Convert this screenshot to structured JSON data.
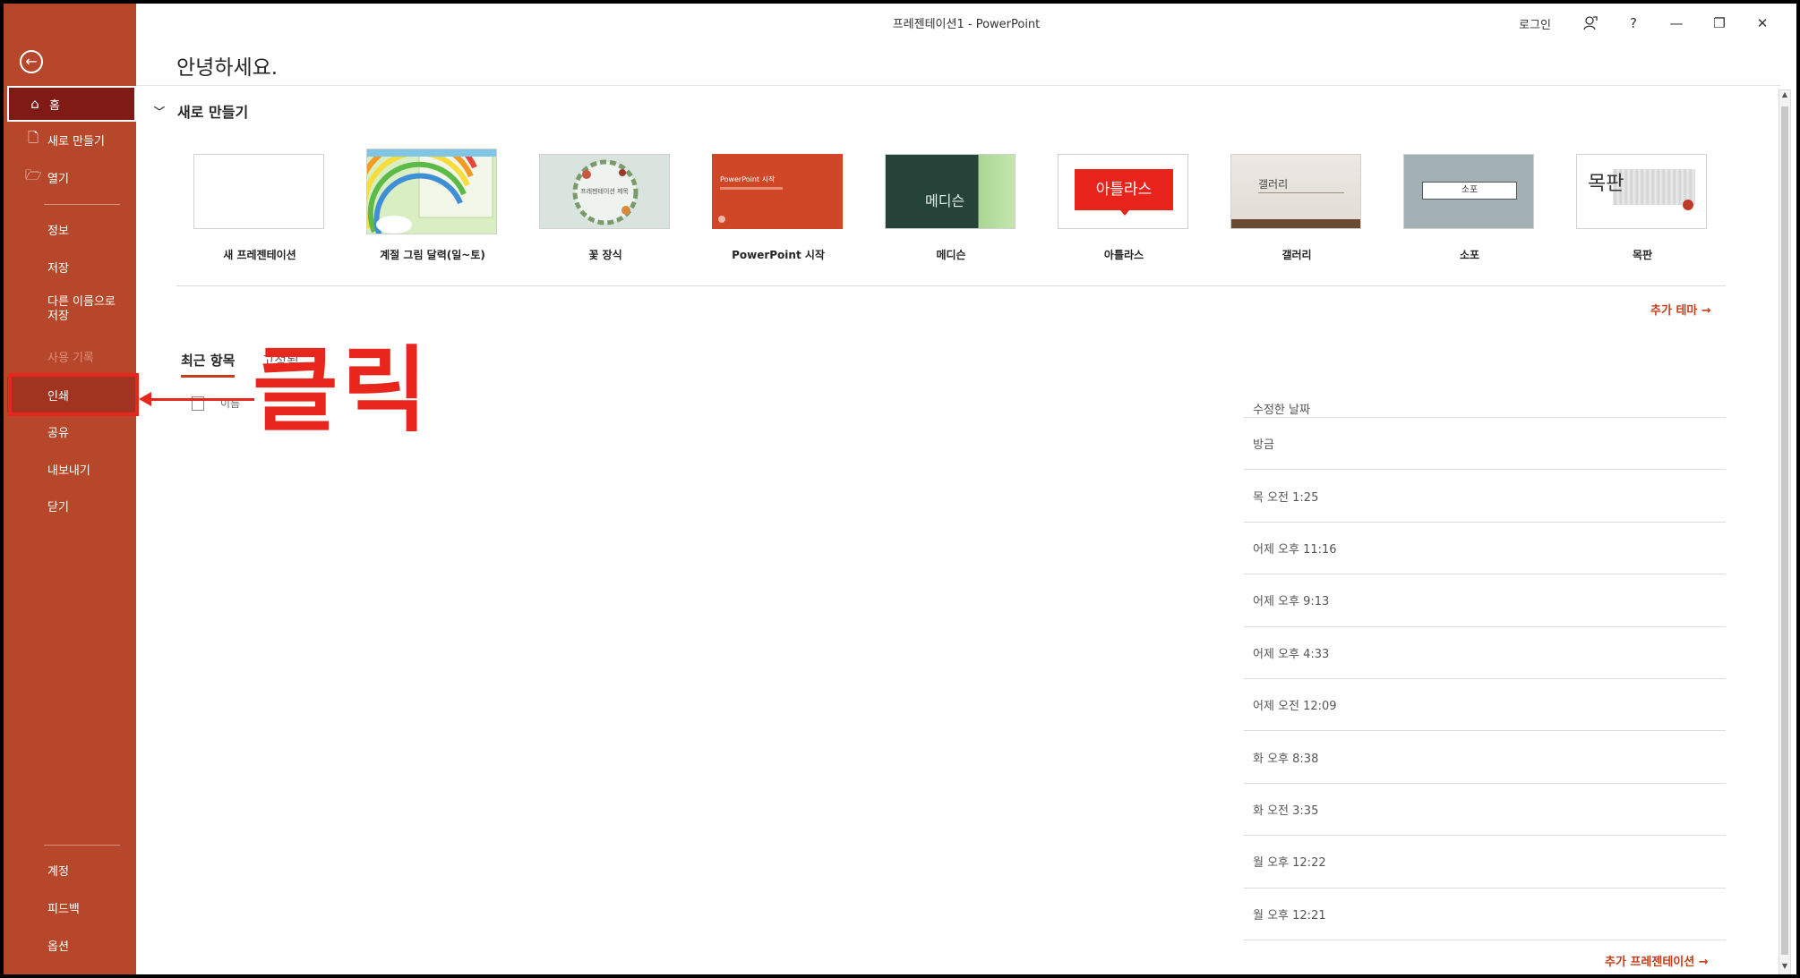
{
  "window": {
    "title": "프레젠테이션1  -  PowerPoint",
    "login": "로그인",
    "help": "?",
    "minimize": "—",
    "restore": "❐",
    "close": "✕"
  },
  "sidebar": {
    "back_icon": "arrow-left-icon",
    "items_top": [
      {
        "label": "홈",
        "icon": "⌂"
      },
      {
        "label": "새로 만들기",
        "icon": "🗋"
      },
      {
        "label": "열기",
        "icon": "🗁"
      }
    ],
    "items_mid": [
      {
        "label": "정보"
      },
      {
        "label": "저장"
      },
      {
        "label": "다른 이름으로 저장"
      },
      {
        "label": "사용 기록"
      },
      {
        "label": "인쇄"
      },
      {
        "label": "공유"
      },
      {
        "label": "내보내기"
      },
      {
        "label": "닫기"
      }
    ],
    "items_bottom": [
      {
        "label": "계정"
      },
      {
        "label": "피드백"
      },
      {
        "label": "옵션"
      }
    ]
  },
  "main": {
    "greeting": "안녕하세요.",
    "new_section": "새로 만들기",
    "templates": [
      {
        "label": "새 프레젠테이션"
      },
      {
        "label": "계절 그림 달력(일~토)"
      },
      {
        "label": "꽃 장식",
        "thumb_text": "프레젠테이션 제목"
      },
      {
        "label": "PowerPoint 시작",
        "thumb_text": "PowerPoint 시작"
      },
      {
        "label": "메디슨",
        "thumb_text": "메디슨"
      },
      {
        "label": "아틀라스",
        "thumb_text": "아틀라스"
      },
      {
        "label": "갤러리",
        "thumb_text": "갤러리"
      },
      {
        "label": "소포",
        "thumb_text": "소포"
      },
      {
        "label": "목판",
        "thumb_text": "목판"
      }
    ],
    "more_themes": "추가 테마 →",
    "tabs": {
      "recent": "최근 항목",
      "pinned": "고정됨"
    },
    "list_name_col": "이름",
    "date_col_head": "수정한 날짜",
    "dates": [
      "방금",
      "목 오전 1:25",
      "어제 오후 11:16",
      "어제 오후 9:13",
      "어제 오후 4:33",
      "어제 오전 12:09",
      "화 오후 8:38",
      "화 오전 3:35",
      "월 오후 12:22",
      "월 오후 12:21"
    ],
    "more_presentations": "추가 프레젠테이션 →"
  },
  "annotation": {
    "text": "클릭"
  },
  "colors": {
    "sidebar": "#b7472a",
    "accent": "#c43e1c",
    "annotation": "#e8261d"
  }
}
